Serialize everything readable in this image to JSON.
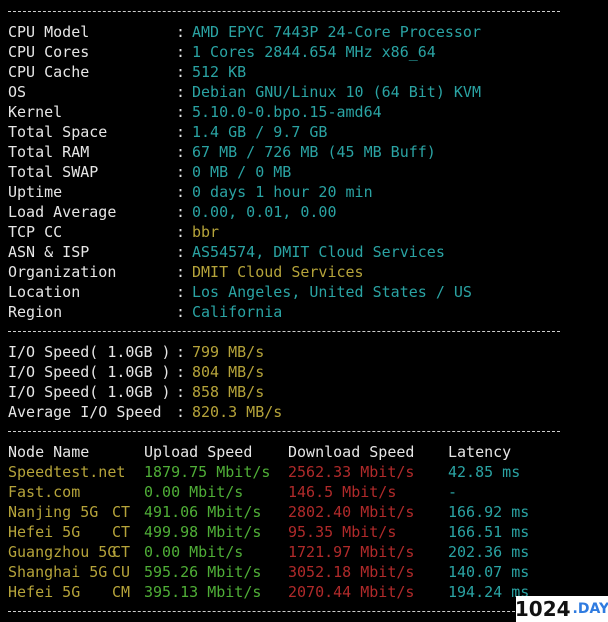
{
  "sysinfo": [
    {
      "label": "CPU Model",
      "value": "AMD EPYC 7443P 24-Core Processor",
      "color": "cyan"
    },
    {
      "label": "CPU Cores",
      "value": "1 Cores 2844.654 MHz x86_64",
      "color": "cyan"
    },
    {
      "label": "CPU Cache",
      "value": "512 KB",
      "color": "cyan"
    },
    {
      "label": "OS",
      "value": "Debian GNU/Linux 10 (64 Bit) KVM",
      "color": "cyan"
    },
    {
      "label": "Kernel",
      "value": "5.10.0-0.bpo.15-amd64",
      "color": "cyan"
    },
    {
      "label": "Total Space",
      "value": "1.4 GB / 9.7 GB",
      "color": "cyan"
    },
    {
      "label": "Total RAM",
      "value": "67 MB / 726 MB (45 MB Buff)",
      "color": "cyan"
    },
    {
      "label": "Total SWAP",
      "value": "0 MB / 0 MB",
      "color": "cyan"
    },
    {
      "label": "Uptime",
      "value": "0 days 1 hour 20 min",
      "color": "cyan"
    },
    {
      "label": "Load Average",
      "value": "0.00, 0.01, 0.00",
      "color": "cyan"
    },
    {
      "label": "TCP CC",
      "value": "bbr",
      "color": "yellow"
    },
    {
      "label": "ASN & ISP",
      "value": "AS54574, DMIT Cloud Services",
      "color": "cyan"
    },
    {
      "label": "Organization",
      "value": "DMIT Cloud Services",
      "color": "yellow"
    },
    {
      "label": "Location",
      "value": "Los Angeles, United States / US",
      "color": "cyan"
    },
    {
      "label": "Region",
      "value": "California",
      "color": "cyan"
    }
  ],
  "io": [
    {
      "label": "I/O Speed( 1.0GB )",
      "value": "799 MB/s"
    },
    {
      "label": "I/O Speed( 1.0GB )",
      "value": "804 MB/s"
    },
    {
      "label": "I/O Speed( 1.0GB )",
      "value": "858 MB/s"
    },
    {
      "label": "Average I/O Speed",
      "value": "820.3 MB/s"
    }
  ],
  "speedtest": {
    "headers": {
      "node": "Node Name",
      "upload": "Upload Speed",
      "download": "Download Speed",
      "latency": "Latency"
    },
    "rows": [
      {
        "node": "Speedtest.net",
        "isp": "",
        "upload": "1879.75 Mbit/s",
        "download": "2562.33 Mbit/s",
        "latency": "42.85 ms"
      },
      {
        "node": "Fast.com",
        "isp": "",
        "upload": "0.00 Mbit/s",
        "download": "146.5 Mbit/s",
        "latency": "-"
      },
      {
        "node": "Nanjing 5G",
        "isp": "CT",
        "upload": "491.06 Mbit/s",
        "download": "2802.40 Mbit/s",
        "latency": "166.92 ms"
      },
      {
        "node": "Hefei 5G",
        "isp": "CT",
        "upload": "499.98 Mbit/s",
        "download": "95.35 Mbit/s",
        "latency": "166.51 ms"
      },
      {
        "node": "Guangzhou 5G",
        "isp": "CT",
        "upload": "0.00 Mbit/s",
        "download": "1721.97 Mbit/s",
        "latency": "202.36 ms"
      },
      {
        "node": "Shanghai 5G",
        "isp": "CU",
        "upload": "595.26 Mbit/s",
        "download": "3052.18 Mbit/s",
        "latency": "140.07 ms"
      },
      {
        "node": "Hefei 5G",
        "isp": "CM",
        "upload": "395.13 Mbit/s",
        "download": "2070.44 Mbit/s",
        "latency": "194.24 ms"
      }
    ]
  },
  "separator": ":",
  "watermark": {
    "num": "1024",
    "day": ".DAY"
  }
}
